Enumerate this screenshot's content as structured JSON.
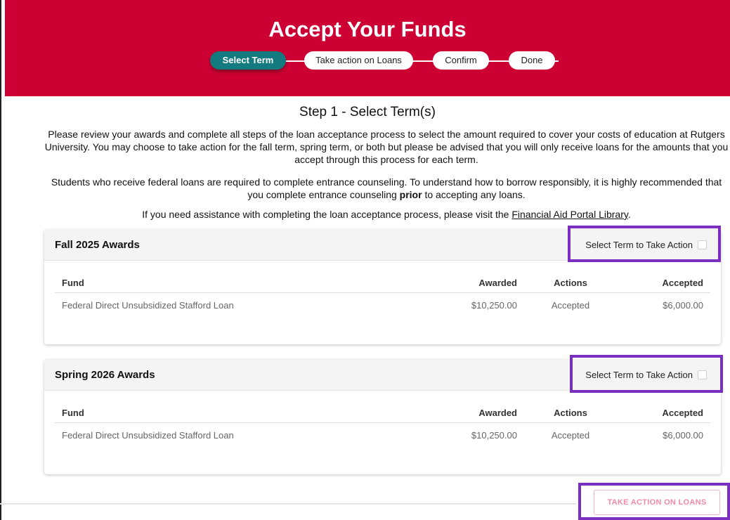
{
  "header": {
    "title": "Accept Your Funds",
    "steps": [
      "Select Term",
      "Take action on Loans",
      "Confirm",
      "Done"
    ]
  },
  "main": {
    "step_heading": "Step 1 - Select Term(s)",
    "para1": "Please review your awards and complete all steps of the loan acceptance process to select the amount required to cover your costs of education at Rutgers University. You may choose to take action for the fall term, spring term, or both but please be advised that you will only receive loans for the amounts that you accept through this process for each term.",
    "para2_before": "Students who receive federal loans are required to complete entrance counseling. To understand how to borrow responsibly, it is highly recommended that you complete entrance counseling ",
    "para2_bold": "prior",
    "para2_after": " to accepting any loans.",
    "para3_before": "If you need assistance with completing the loan acceptance process, please visit the ",
    "para3_link": "Financial Aid Portal Library",
    "para3_after": "."
  },
  "table_headers": {
    "fund": "Fund",
    "awarded": "Awarded",
    "actions": "Actions",
    "accepted": "Accepted"
  },
  "terms": [
    {
      "title": "Fall 2025 Awards",
      "select_label": "Select Term to Take Action",
      "rows": [
        {
          "fund": "Federal Direct Unsubsidized Stafford Loan",
          "awarded": "$10,250.00",
          "actions": "Accepted",
          "accepted": "$6,000.00"
        }
      ]
    },
    {
      "title": "Spring 2026 Awards",
      "select_label": "Select Term to Take Action",
      "rows": [
        {
          "fund": "Federal Direct Unsubsidized Stafford Loan",
          "awarded": "$10,250.00",
          "actions": "Accepted",
          "accepted": "$6,000.00"
        }
      ]
    }
  ],
  "footer": {
    "take_action_label": "TAKE ACTION ON LOANS"
  },
  "colors": {
    "brand": "#cc0033",
    "active_step": "#137a80",
    "highlight": "#7b2fbf"
  }
}
